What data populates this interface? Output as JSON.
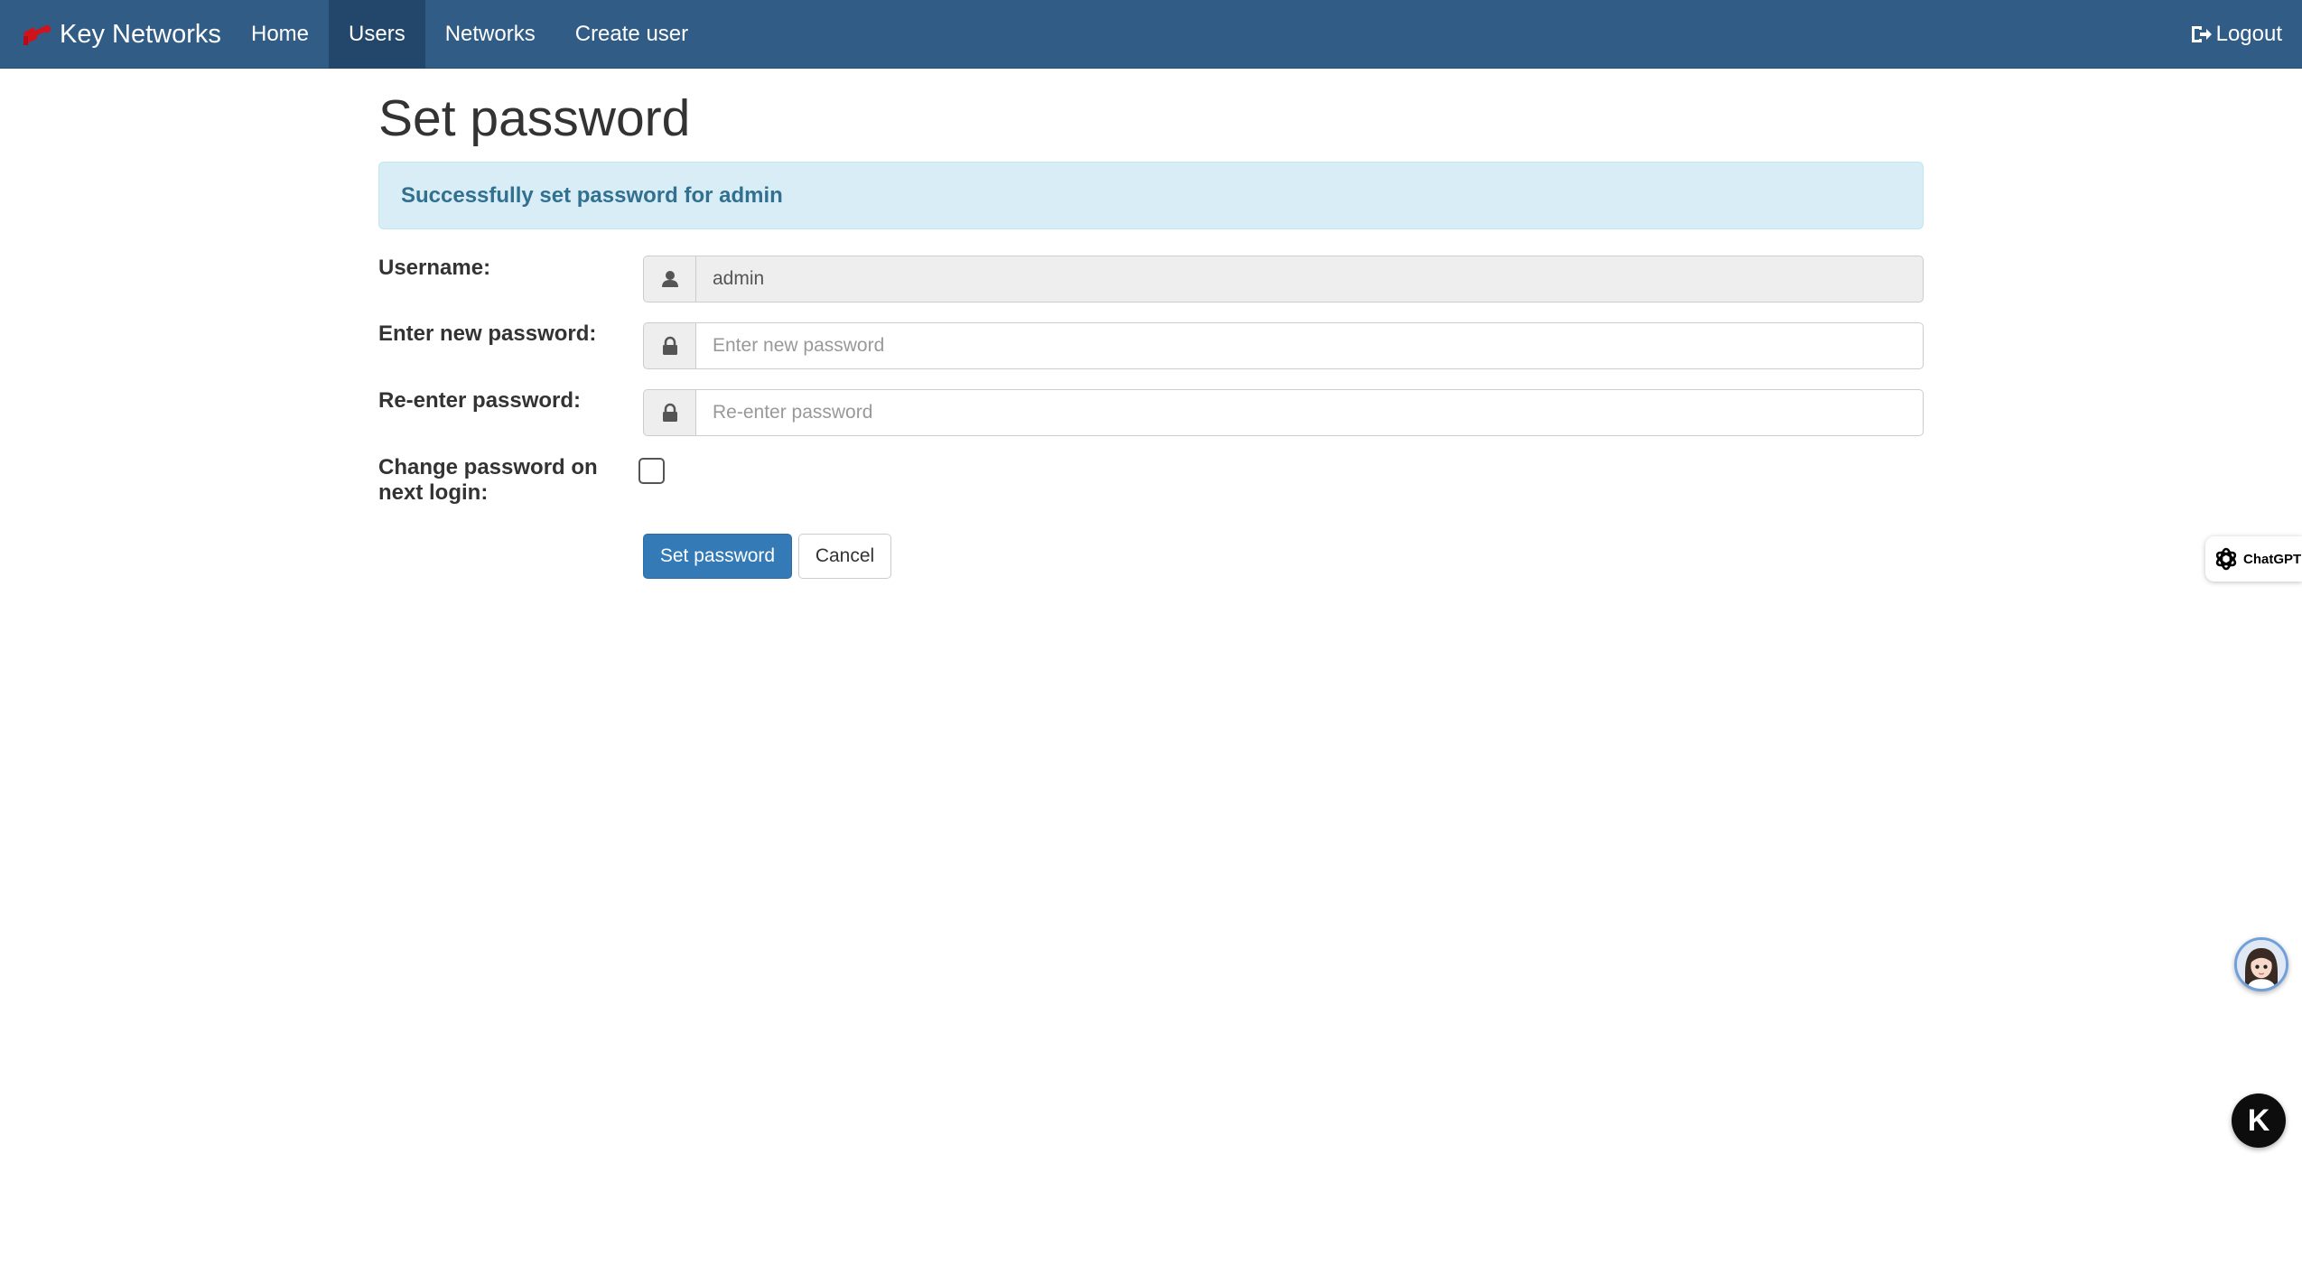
{
  "navbar": {
    "brand": "Key Networks",
    "items": [
      {
        "label": "Home",
        "active": false
      },
      {
        "label": "Users",
        "active": true
      },
      {
        "label": "Networks",
        "active": false
      },
      {
        "label": "Create user",
        "active": false
      }
    ],
    "logout_label": "Logout"
  },
  "page": {
    "title": "Set password"
  },
  "alert": {
    "message": "Successfully set password for admin"
  },
  "form": {
    "username_label": "Username:",
    "username_value": "admin",
    "new_password_label": "Enter new password:",
    "new_password_placeholder": "Enter new password",
    "reenter_password_label": "Re-enter password:",
    "reenter_password_placeholder": "Re-enter password",
    "change_on_login_label": "Change password on next login:",
    "change_on_login_checked": false,
    "submit_label": "Set password",
    "cancel_label": "Cancel"
  },
  "widgets": {
    "chatgpt_label": "ChatGPT",
    "k_label": "K"
  },
  "colors": {
    "navbar": "#315c85",
    "navbar_active": "#22476b",
    "alert_bg": "#d9edf7",
    "alert_text": "#31708f",
    "primary": "#337ab7"
  }
}
